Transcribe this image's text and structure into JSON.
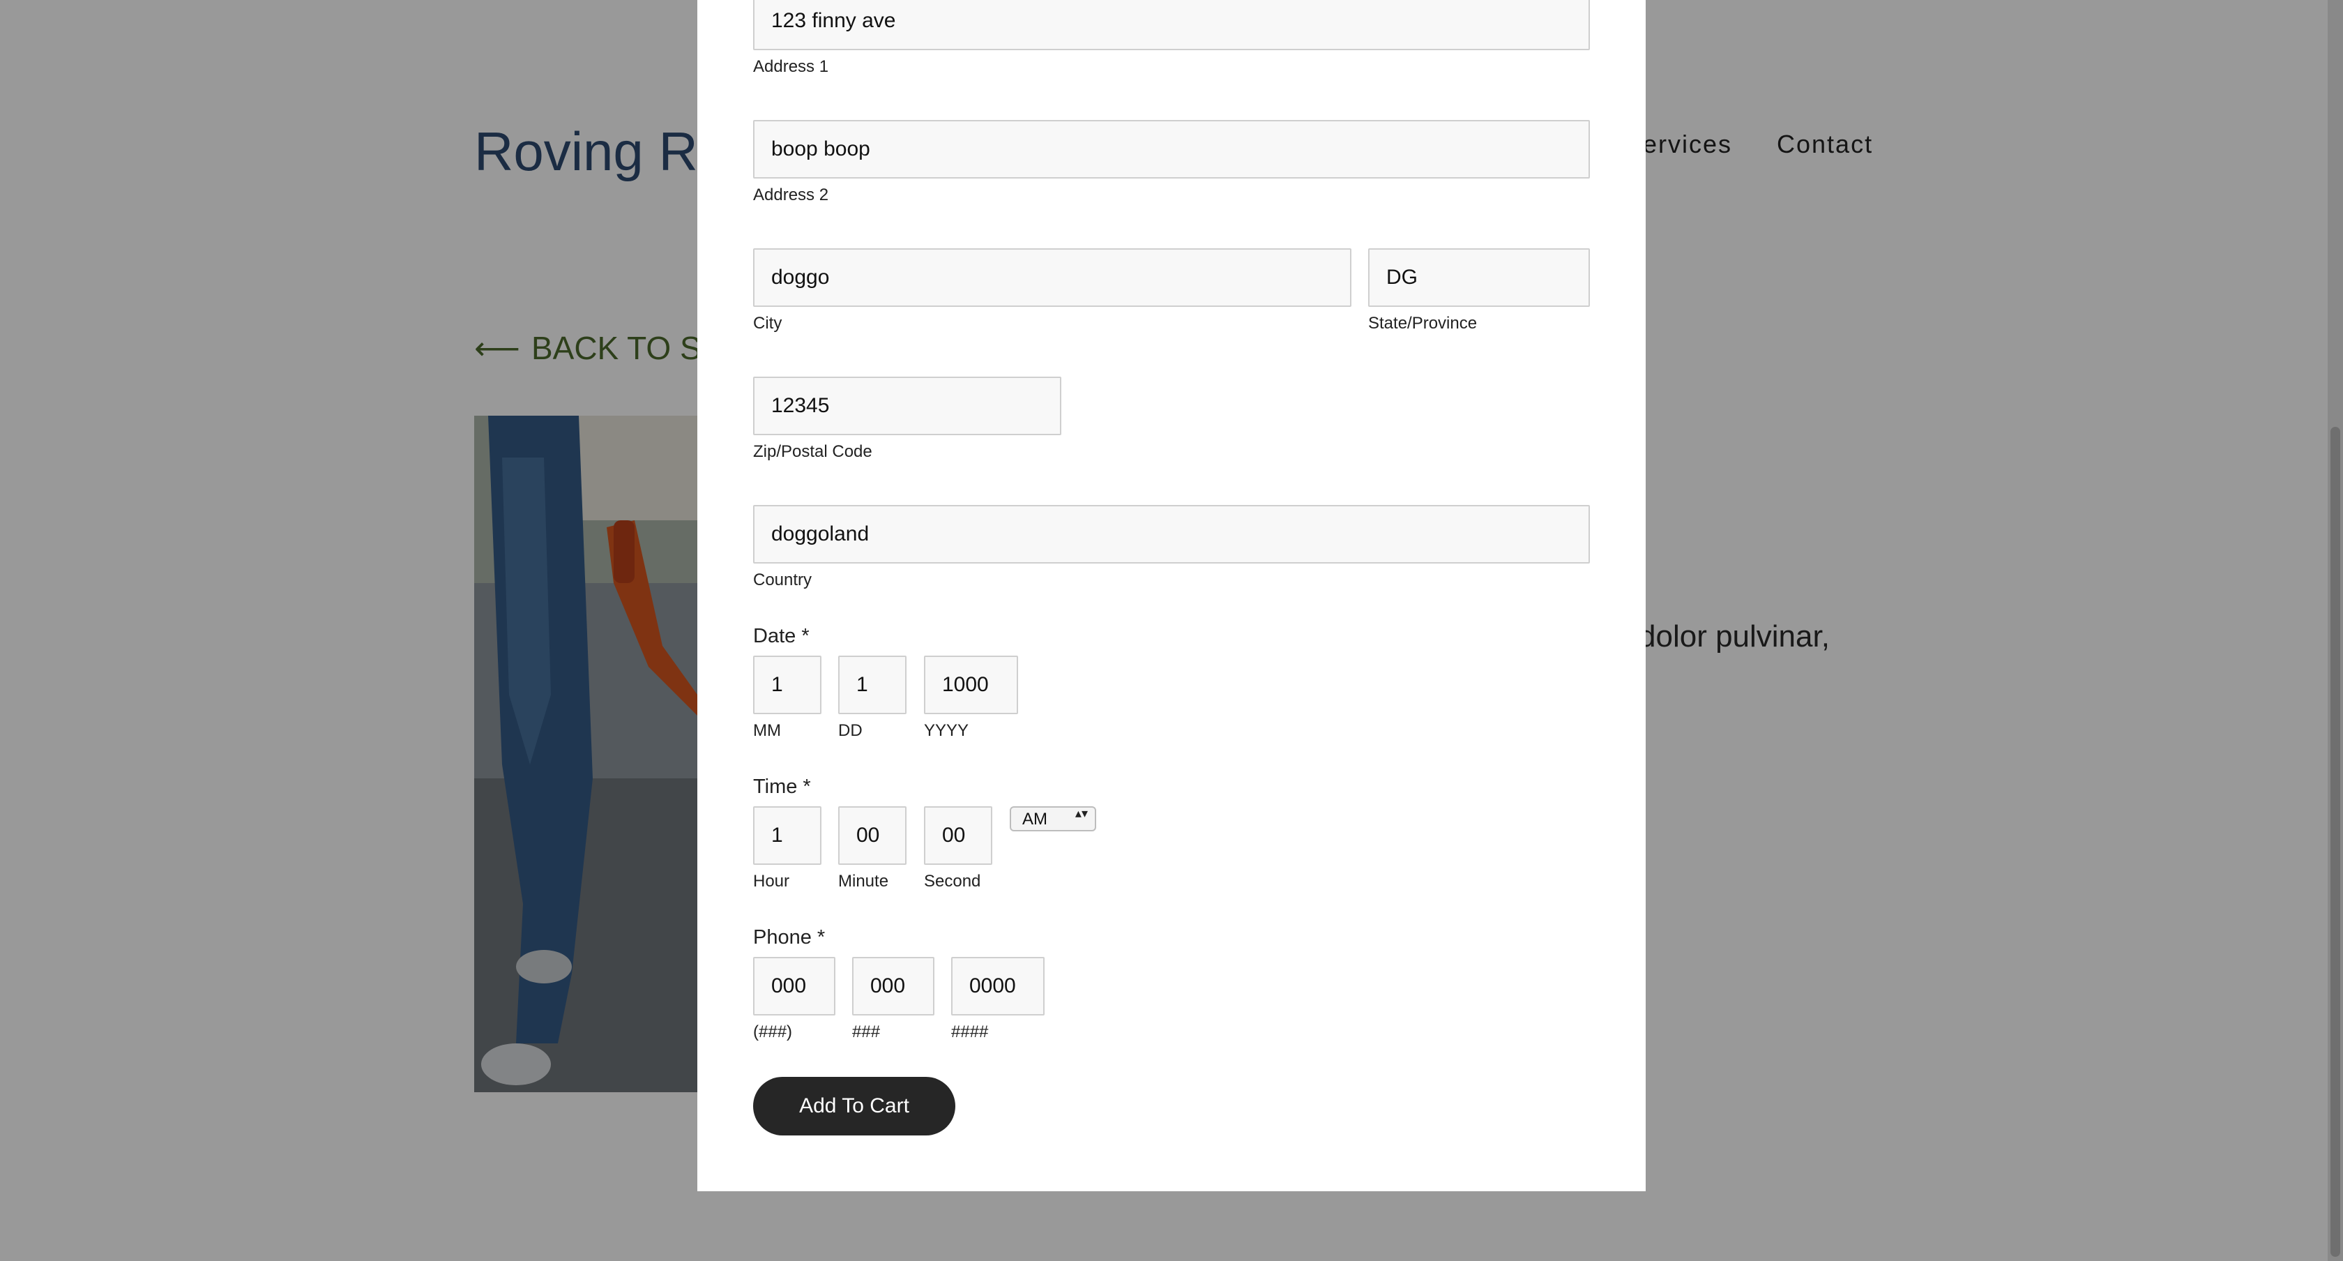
{
  "site": {
    "title": "Roving Ro",
    "nav": {
      "services": "Services",
      "contact": "Contact"
    },
    "back_link": {
      "arrow": "⟵",
      "text": "BACK TO SER"
    },
    "body_text": "dolor pulvinar,"
  },
  "form": {
    "address1": {
      "value": "123 finny ave",
      "label": "Address 1"
    },
    "address2": {
      "value": "boop boop",
      "label": "Address 2"
    },
    "city": {
      "value": "doggo",
      "label": "City"
    },
    "state": {
      "value": "DG",
      "label": "State/Province"
    },
    "zip": {
      "value": "12345",
      "label": "Zip/Postal Code"
    },
    "country": {
      "value": "doggoland",
      "label": "Country"
    },
    "date": {
      "label": "Date *",
      "month": {
        "value": "1",
        "label": "MM"
      },
      "day": {
        "value": "1",
        "label": "DD"
      },
      "year": {
        "value": "1000",
        "label": "YYYY"
      }
    },
    "time": {
      "label": "Time *",
      "hour": {
        "value": "1",
        "label": "Hour"
      },
      "minute": {
        "value": "00",
        "label": "Minute"
      },
      "second": {
        "value": "00",
        "label": "Second"
      },
      "ampm": "AM",
      "ampm_chevron": "▴▾"
    },
    "phone": {
      "label": "Phone *",
      "area": {
        "value": "000",
        "label": "(###)"
      },
      "prefix": {
        "value": "000",
        "label": "###"
      },
      "line": {
        "value": "0000",
        "label": "####"
      }
    },
    "submit_label": "Add To Cart"
  }
}
